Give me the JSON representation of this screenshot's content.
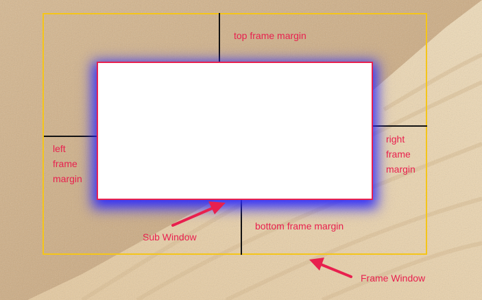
{
  "labels": {
    "top_margin": "top frame margin",
    "left_margin": [
      "left",
      "frame",
      "margin"
    ],
    "right_margin": [
      "right",
      "frame",
      "margin"
    ],
    "bottom_margin": "bottom frame margin",
    "sub_window": "Sub Window",
    "frame_window": "Frame Window"
  },
  "colors": {
    "frame_border": "#f5c518",
    "sub_window_border": "#e8204e",
    "sub_window_glow": "#2828ff",
    "label_text": "#e8204e",
    "arrow": "#e8204e",
    "margin_line": "#111111",
    "sand_dark": "#c9a57a",
    "sand_light": "#edd6b0"
  }
}
